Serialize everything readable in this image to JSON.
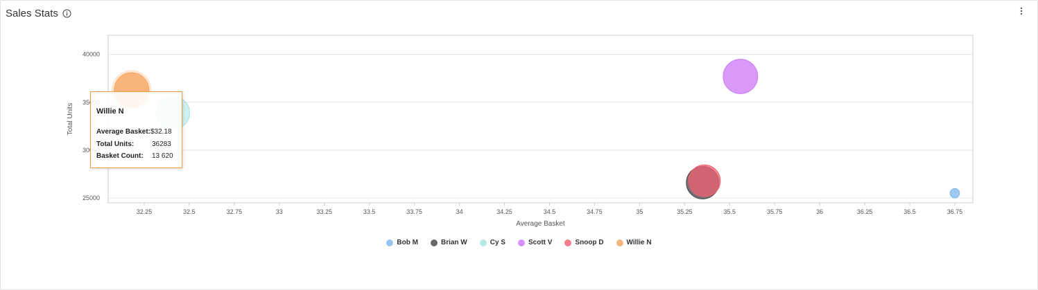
{
  "widget": {
    "title": "Sales Stats"
  },
  "icons": {
    "info": "info-circle-icon",
    "menu": "vertical-ellipsis-icon"
  },
  "chart_data": {
    "type": "bubble",
    "title": "",
    "xlabel": "Average Basket",
    "ylabel": "Total Units",
    "xlim": [
      32.05,
      36.85
    ],
    "ylim": [
      24500,
      42000
    ],
    "x_ticks": [
      32.25,
      32.5,
      32.75,
      33,
      33.25,
      33.5,
      33.75,
      34,
      34.25,
      34.5,
      34.75,
      35,
      35.25,
      35.5,
      35.75,
      36,
      36.25,
      36.5,
      36.75
    ],
    "x_tick_labels": [
      "32.25",
      "32.5",
      "32.75",
      "33",
      "33.25",
      "33.5",
      "33.75",
      "34",
      "34.25",
      "34.5",
      "34.75",
      "35",
      "35.25",
      "35.5",
      "35.75",
      "36",
      "36.25",
      "36.5",
      "36.75"
    ],
    "y_ticks": [
      25000,
      30000,
      35000,
      40000
    ],
    "y_tick_labels": [
      "25000",
      "30000",
      "35000",
      "40000"
    ],
    "grid": "horizontal",
    "legend_position": "bottom",
    "series": [
      {
        "name": "Bob M",
        "color": "#7cb5ec",
        "x": 36.75,
        "y": 25500,
        "size": 1000
      },
      {
        "name": "Brian W",
        "color": "#434348",
        "x": 35.35,
        "y": 26600,
        "size": 12000
      },
      {
        "name": "Cy S",
        "color": "#a6e3e0",
        "x": 32.41,
        "y": 33900,
        "size": 12500
      },
      {
        "name": "Scott V",
        "color": "#cc77f7",
        "x": 35.56,
        "y": 37700,
        "size": 13500
      },
      {
        "name": "Snoop D",
        "color": "#f16071",
        "x": 35.36,
        "y": 26800,
        "size": 11500
      },
      {
        "name": "Willie N",
        "color": "#f7a35c",
        "x": 32.18,
        "y": 36283,
        "size": 13620
      }
    ]
  },
  "tooltip": {
    "series_name": "Willie N",
    "rows": [
      {
        "label": "Average Basket:",
        "value": "$32.18"
      },
      {
        "label": "Total Units:",
        "value": "36283"
      },
      {
        "label": "Basket Count:",
        "value": "13 620"
      }
    ]
  }
}
